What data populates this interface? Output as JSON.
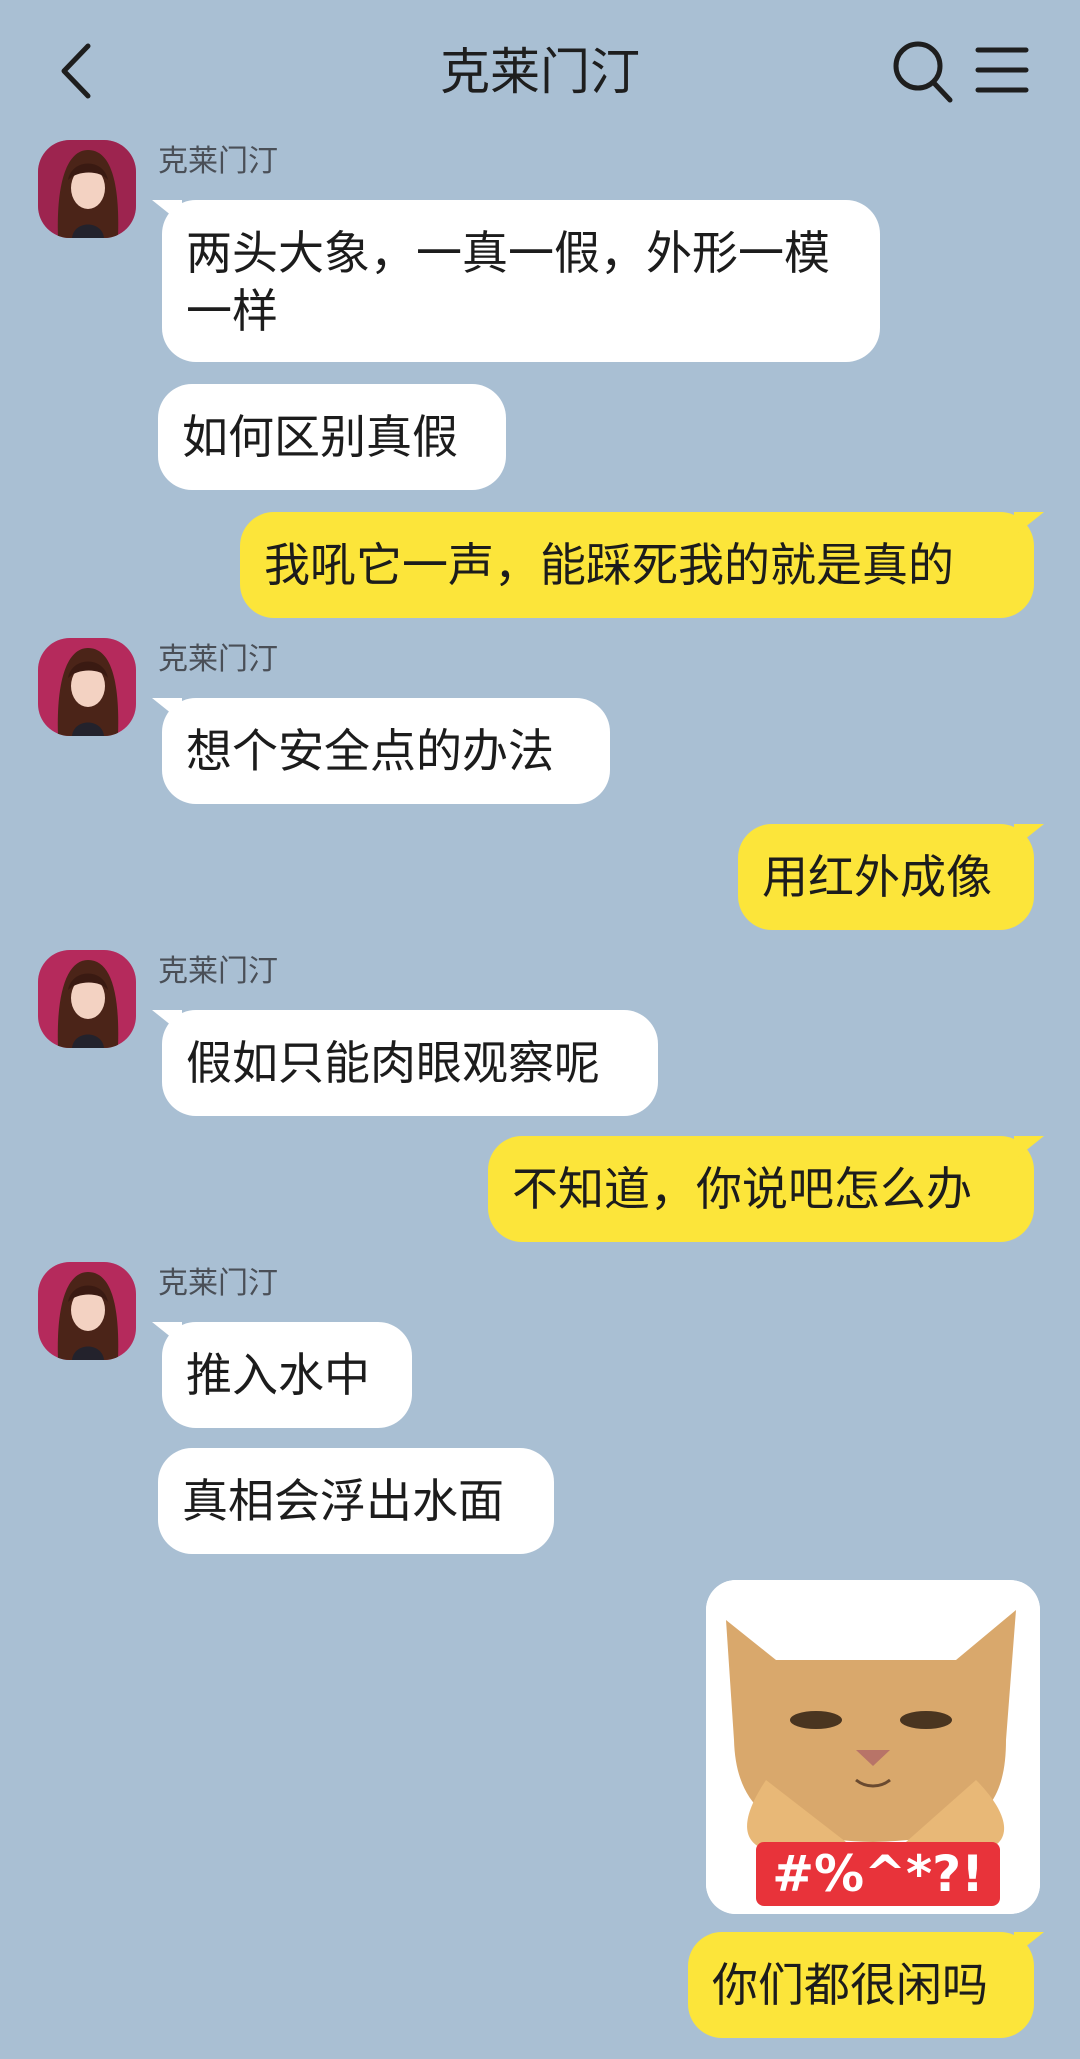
{
  "header": {
    "title": "克莱门汀",
    "back_icon": "chevron-left-icon",
    "search_icon": "search-icon",
    "menu_icon": "hamburger-menu-icon"
  },
  "colors": {
    "background": "#a9bfd3",
    "incoming_bubble": "#ffffff",
    "outgoing_bubble": "#fce53a"
  },
  "messages": [
    {
      "from": "克莱门汀",
      "text": "两头大象，一真一假，外形一模一样"
    },
    {
      "from": "克莱门汀",
      "text": "如何区别真假"
    },
    {
      "from": "me",
      "text": "我吼它一声，能踩死我的就是真的"
    },
    {
      "from": "克莱门汀",
      "text": "想个安全点的办法"
    },
    {
      "from": "me",
      "text": "用红外成像"
    },
    {
      "from": "克莱门汀",
      "text": "假如只能肉眼观察呢"
    },
    {
      "from": "me",
      "text": "不知道，你说吧怎么办"
    },
    {
      "from": "克莱门汀",
      "text": "推入水中"
    },
    {
      "from": "克莱门汀",
      "text": "真相会浮出水面"
    },
    {
      "from": "me",
      "sticker": "angry-cat-sticker",
      "text": "#%^*?!"
    },
    {
      "from": "me",
      "text": "你们都很闲吗"
    }
  ],
  "sender_names": [
    "克莱门汀",
    "克莱门汀",
    "克莱门汀",
    "克莱门汀"
  ]
}
